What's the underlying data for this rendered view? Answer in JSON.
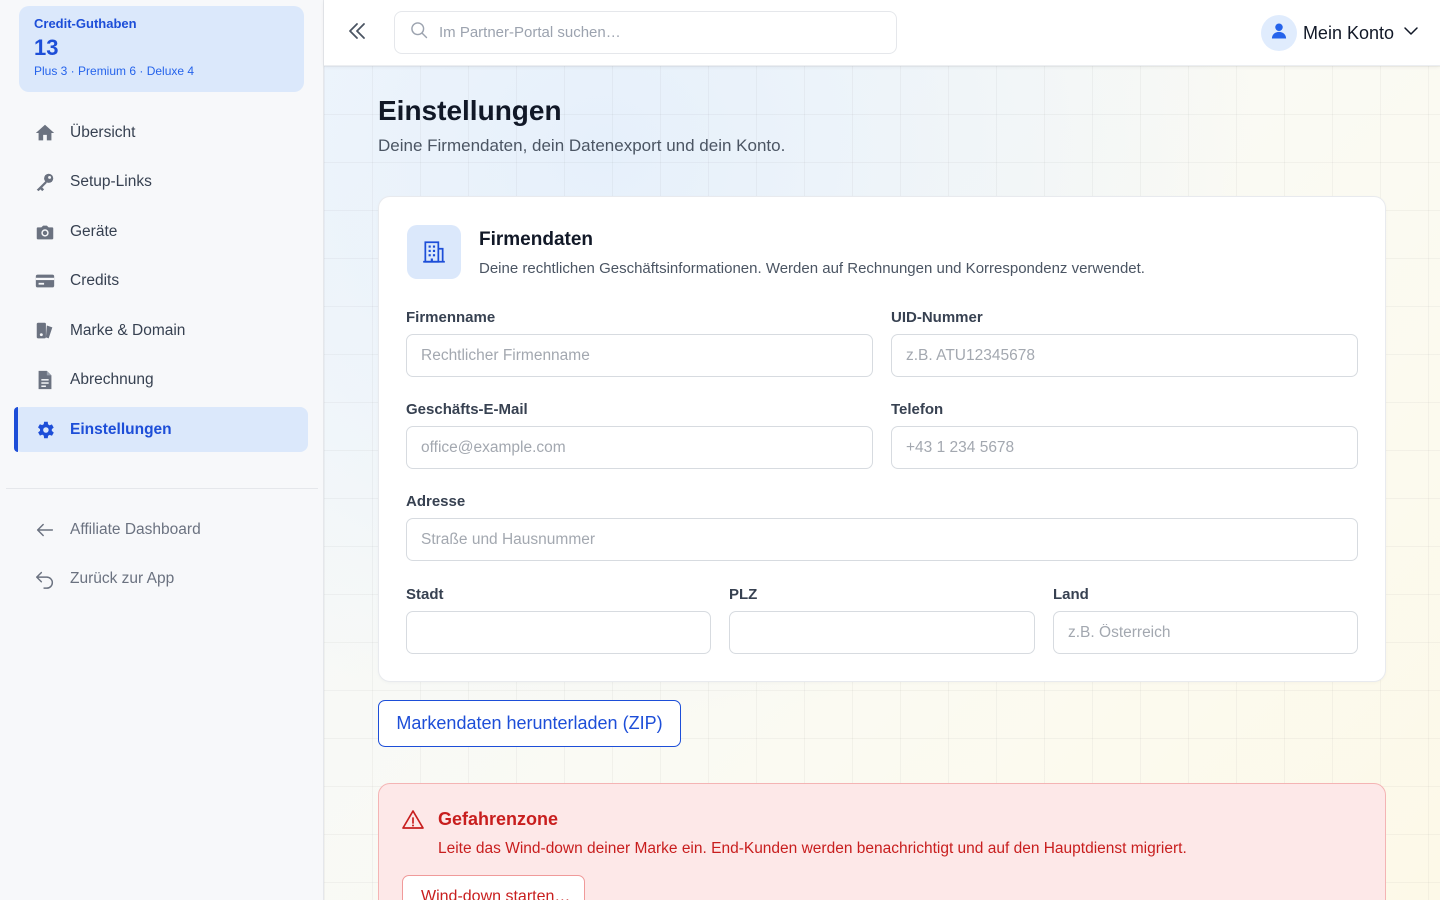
{
  "credits": {
    "label": "Credit-Guthaben",
    "value": "13",
    "breakdown": "Plus 3 · Premium 6 · Deluxe 4"
  },
  "sidebar": {
    "items": [
      {
        "label": "Übersicht",
        "icon": "home-icon"
      },
      {
        "label": "Setup-Links",
        "icon": "key-icon"
      },
      {
        "label": "Geräte",
        "icon": "camera-icon"
      },
      {
        "label": "Credits",
        "icon": "credit-card-icon"
      },
      {
        "label": "Marke & Domain",
        "icon": "brand-icon"
      },
      {
        "label": "Abrechnung",
        "icon": "document-icon"
      },
      {
        "label": "Einstellungen",
        "icon": "gear-icon",
        "active": true
      }
    ],
    "secondary": [
      {
        "label": "Affiliate Dashboard",
        "icon": "arrow-left-icon"
      },
      {
        "label": "Zurück zur App",
        "icon": "return-icon"
      }
    ]
  },
  "topbar": {
    "search_placeholder": "Im Partner-Portal suchen…",
    "account_label": "Mein Konto"
  },
  "page": {
    "title": "Einstellungen",
    "subtitle": "Deine Firmendaten, dein Datenexport und dein Konto."
  },
  "company": {
    "title": "Firmendaten",
    "description": "Deine rechtlichen Geschäftsinformationen. Werden auf Rechnungen und Korrespondenz verwendet.",
    "fields": {
      "name": {
        "label": "Firmenname",
        "placeholder": "Rechtlicher Firmenname",
        "value": ""
      },
      "uid": {
        "label": "UID-Nummer",
        "placeholder": "z.B. ATU12345678",
        "value": ""
      },
      "email": {
        "label": "Geschäfts-E-Mail",
        "placeholder": "office@example.com",
        "value": ""
      },
      "phone": {
        "label": "Telefon",
        "placeholder": "+43 1 234 5678",
        "value": ""
      },
      "address": {
        "label": "Adresse",
        "placeholder": "Straße und Hausnummer",
        "value": ""
      },
      "city": {
        "label": "Stadt",
        "placeholder": "",
        "value": ""
      },
      "zip": {
        "label": "PLZ",
        "placeholder": "",
        "value": ""
      },
      "country": {
        "label": "Land",
        "placeholder": "z.B. Österreich",
        "value": ""
      }
    }
  },
  "export": {
    "button_label": "Markendaten herunterladen (ZIP)"
  },
  "danger": {
    "title": "Gefahrenzone",
    "description": "Leite das Wind-down deiner Marke ein. End-Kunden werden benachrichtigt und auf den Hauptdienst migriert.",
    "button_label": "Wind-down starten…"
  },
  "colors": {
    "accent": "#1d4ed8",
    "accent_soft": "#dbe8fb",
    "danger": "#c81e1e",
    "danger_bg": "#fde8e8"
  }
}
